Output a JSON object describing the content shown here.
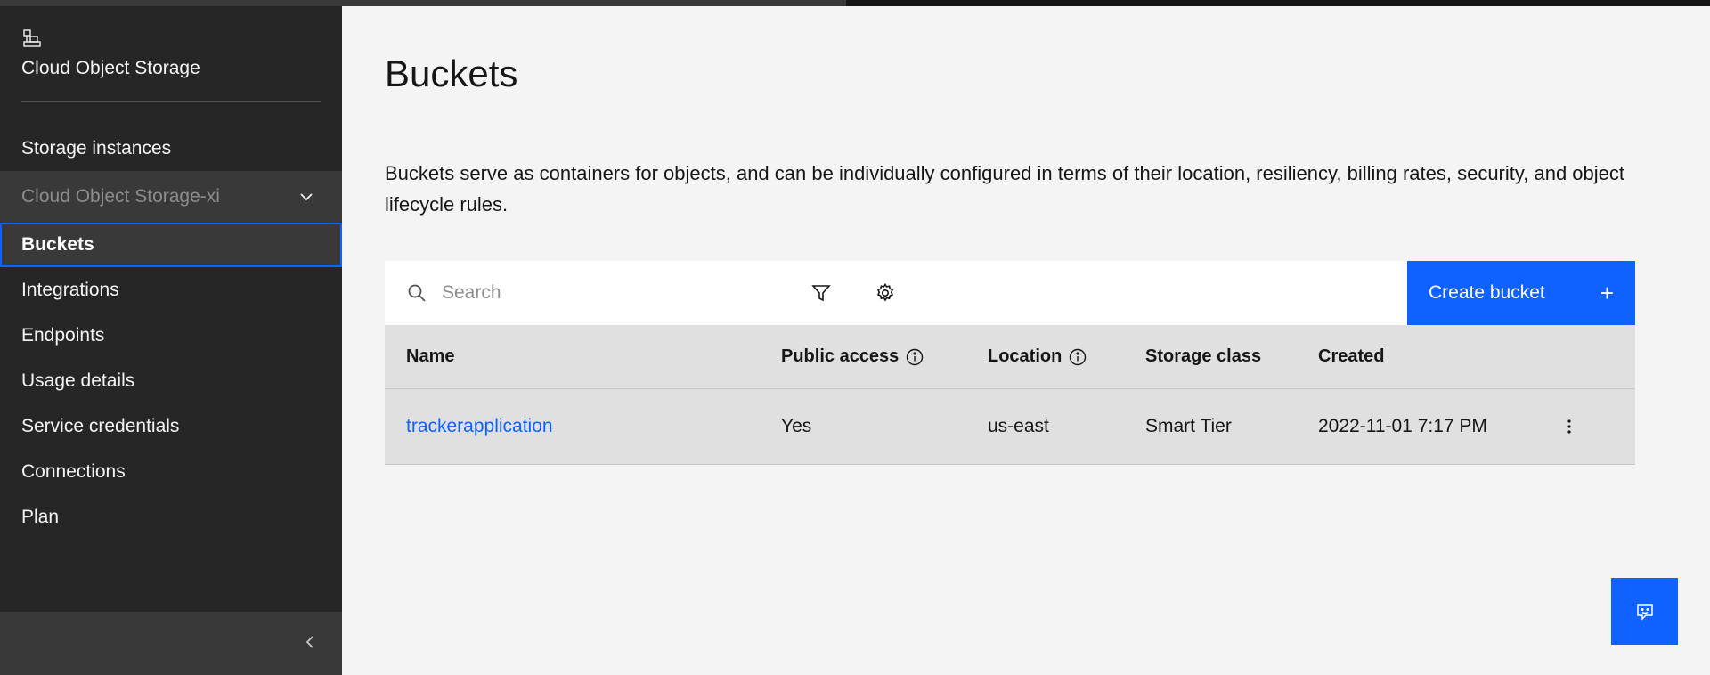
{
  "sidebar": {
    "service_title": "Cloud Object Storage",
    "items": [
      {
        "label": "Storage instances"
      },
      {
        "label": "Cloud Object Storage-xi"
      },
      {
        "label": "Buckets"
      },
      {
        "label": "Integrations"
      },
      {
        "label": "Endpoints"
      },
      {
        "label": "Usage details"
      },
      {
        "label": "Service credentials"
      },
      {
        "label": "Connections"
      },
      {
        "label": "Plan"
      }
    ]
  },
  "page": {
    "title": "Buckets",
    "description": "Buckets serve as containers for objects, and can be individually configured in terms of their location, resiliency, billing rates, security, and object lifecycle rules."
  },
  "toolbar": {
    "search_placeholder": "Search",
    "create_label": "Create bucket",
    "create_icon": "+"
  },
  "table": {
    "columns": [
      "Name",
      "Public access",
      "Location",
      "Storage class",
      "Created"
    ],
    "rows": [
      {
        "name": "trackerapplication",
        "public_access": "Yes",
        "location": "us-east",
        "storage_class": "Smart Tier",
        "created": "2022-11-01 7:17 PM"
      }
    ]
  },
  "colors": {
    "accent": "#0f62fe",
    "sidebar_bg": "#262626",
    "header_row_bg": "#e0e0e0"
  },
  "icons": [
    "cloud-object-storage-icon",
    "chevron-down-icon",
    "chevron-left-icon",
    "search-icon",
    "filter-icon",
    "settings-icon",
    "info-icon",
    "overflow-menu-icon",
    "feedback-icon"
  ]
}
